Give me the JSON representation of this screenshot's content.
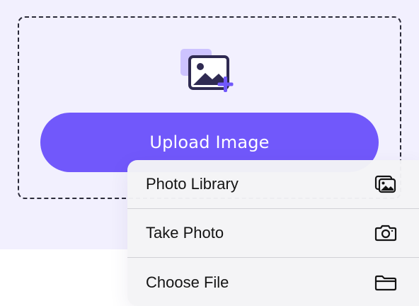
{
  "upload_area": {
    "button_label": "Upload Image",
    "icon": "image-add-icon",
    "accent_color": "#7158fb",
    "background_color": "#f2f0fe"
  },
  "menu": {
    "items": [
      {
        "label": "Photo Library",
        "icon": "photo-library-icon"
      },
      {
        "label": "Take Photo",
        "icon": "camera-icon"
      },
      {
        "label": "Choose File",
        "icon": "folder-icon"
      }
    ]
  }
}
